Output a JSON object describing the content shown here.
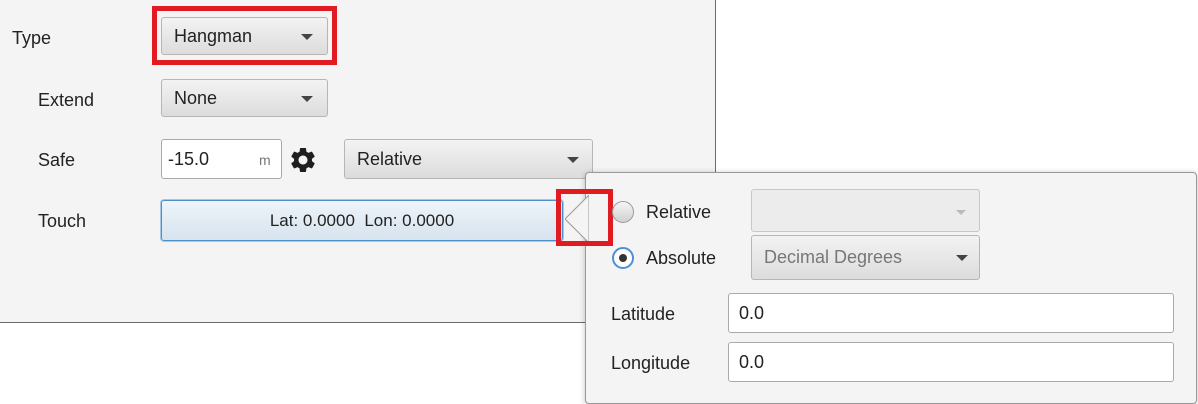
{
  "form": {
    "type": {
      "label": "Type",
      "value": "Hangman"
    },
    "extend": {
      "label": "Extend",
      "value": "None"
    },
    "safe": {
      "label": "Safe",
      "value": "-15.0",
      "unit": "m",
      "mode": "Relative"
    },
    "touch": {
      "label": "Touch",
      "value": "Lat: 0.0000  Lon: 0.0000"
    }
  },
  "popup": {
    "relative_label": "Relative",
    "absolute_label": "Absolute",
    "absolute_format": "Decimal Degrees",
    "latitude_label": "Latitude",
    "latitude_value": "0.0",
    "longitude_label": "Longitude",
    "longitude_value": "0.0"
  },
  "colors": {
    "highlight": "#e11b22",
    "focus": "#4a8fd8"
  },
  "icons": {
    "settings": "gear-icon"
  }
}
